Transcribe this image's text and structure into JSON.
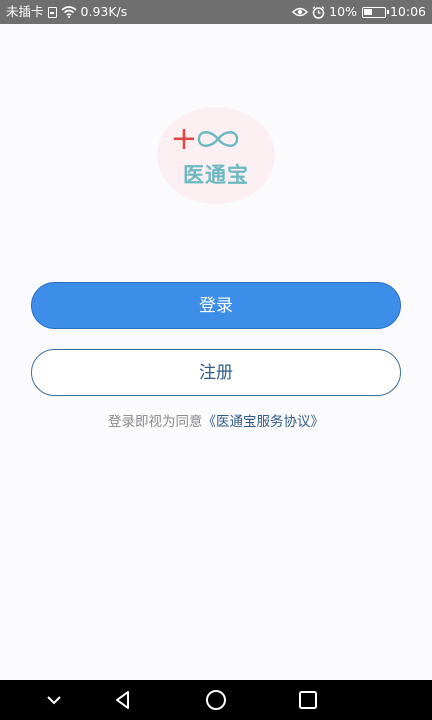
{
  "status_bar": {
    "carrier": "未插卡",
    "network_speed": "0.93K/s",
    "battery": "10%",
    "time": "10:06",
    "icons": [
      "sim-icon",
      "wifi-icon",
      "eye-icon",
      "alarm-icon",
      "battery-icon"
    ]
  },
  "logo": {
    "text": "医通宝",
    "icons": [
      "plus-icon",
      "infinity-icon"
    ],
    "colors": {
      "plus": "#e0454a",
      "infinity": "#6cb9c1",
      "text": "#6cb9c1",
      "background": "#fbeff1"
    }
  },
  "login_button": {
    "label": "登录"
  },
  "register_button": {
    "label": "注册"
  },
  "agreement": {
    "prefix": "登录即视为同意",
    "link": "《医通宝服务协议》"
  },
  "nav_bar": {
    "icons": [
      "collapse-icon",
      "back-icon",
      "home-icon",
      "recents-icon"
    ]
  },
  "colors": {
    "accent": "#3c8ee8",
    "link": "#2f5d88",
    "status_bar": "#6f6f6f",
    "nav_bar": "#000000"
  }
}
